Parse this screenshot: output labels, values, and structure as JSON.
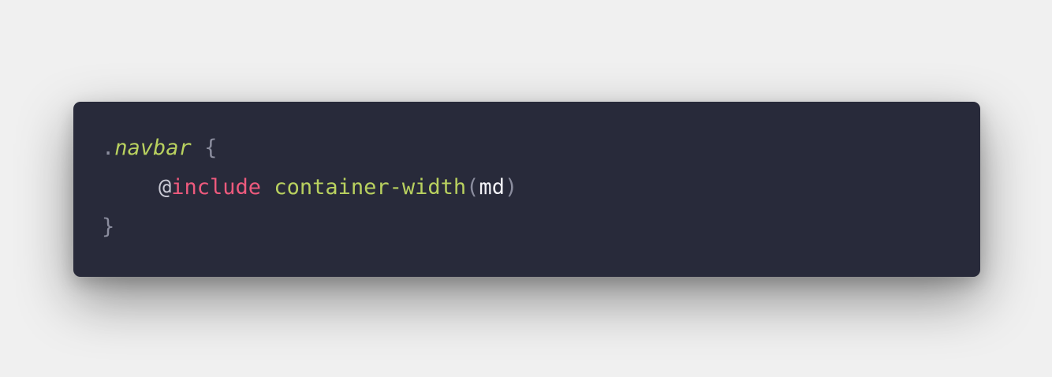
{
  "code_block": {
    "language": "scss",
    "colors": {
      "background": "#282a3a",
      "page_background": "#f0f0f0",
      "punctuation": "#8b8d9e",
      "selector": "#b9d15f",
      "keyword": "#ee5a7d",
      "function": "#b9d15f",
      "argument": "#f2f2f7"
    },
    "lines": [
      {
        "dot": ".",
        "selector": "navbar",
        "space": " ",
        "open_brace": "{"
      },
      {
        "at": "@",
        "keyword": "include",
        "space": " ",
        "function": "container-width",
        "open_paren": "(",
        "argument": "md",
        "close_paren": ")"
      },
      {
        "close_brace": "}"
      }
    ]
  }
}
